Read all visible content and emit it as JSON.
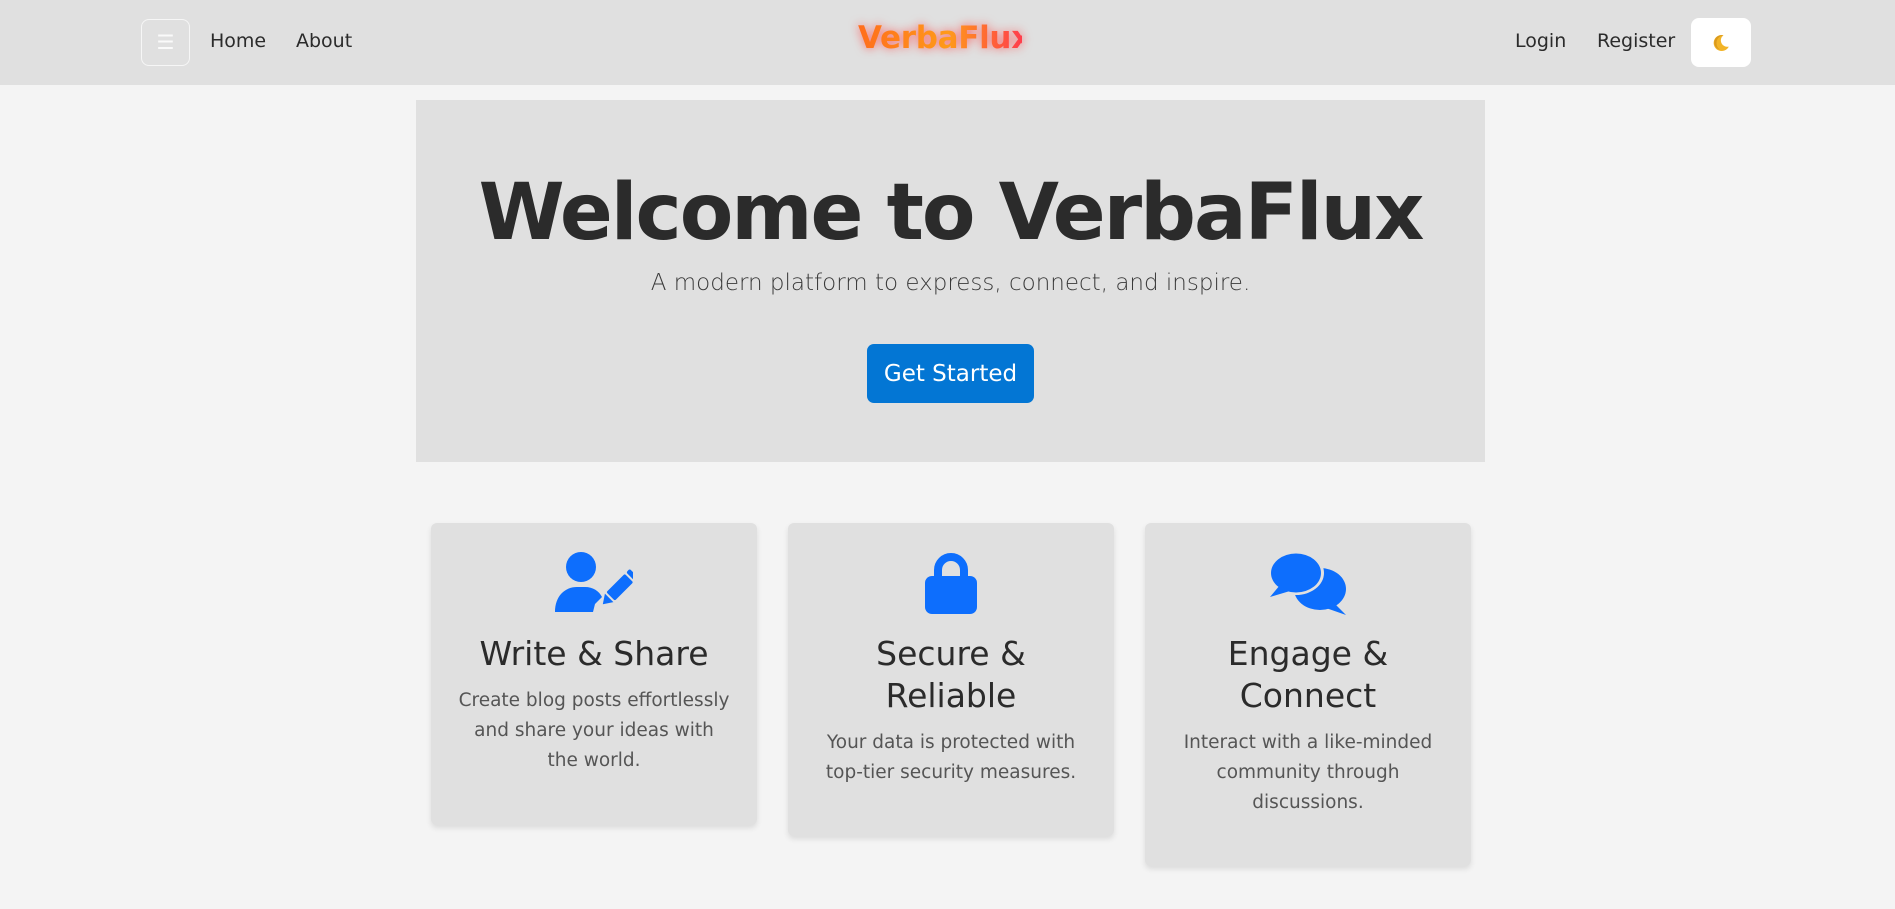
{
  "nav": {
    "menu_glyph": "☰",
    "links": [
      "Home",
      "About"
    ],
    "brand": "VerbaFlux",
    "login": "Login",
    "register": "Register",
    "theme_icon": "moon-icon"
  },
  "hero": {
    "title": "Welcome to VerbaFlux",
    "subtitle": "A modern platform to express, connect, and inspire.",
    "cta": "Get Started"
  },
  "cards": [
    {
      "icon": "user-pen-icon",
      "title": "Write & Share",
      "text": "Create blog posts effortlessly and share your ideas with the world."
    },
    {
      "icon": "lock-icon",
      "title": "Secure & Reliable",
      "text": "Your data is protected with top-tier security measures."
    },
    {
      "icon": "comments-icon",
      "title": "Engage & Connect",
      "text": "Interact with a like-minded community through discussions."
    }
  ],
  "colors": {
    "accent": "#0d6efd",
    "button": "#0376d4",
    "brand_gradient": [
      "#ff6d1c",
      "#ff9a1a",
      "#ff3d4c"
    ],
    "surface": "#e0e0e0",
    "background": "#f4f4f4"
  }
}
